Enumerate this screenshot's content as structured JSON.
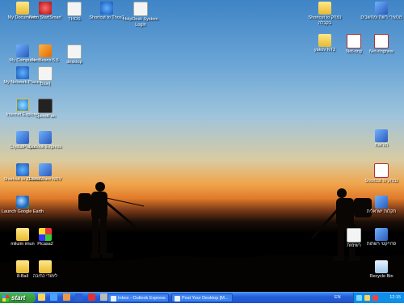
{
  "icons_left": [
    {
      "label": "My Documents",
      "glyph": "g-folder",
      "icon": "my-documents-icon"
    },
    {
      "label": "Nero StartSmart",
      "glyph": "g-red",
      "icon": "nero-icon"
    },
    {
      "label": "THOS",
      "glyph": "g-doc",
      "icon": "document-icon"
    },
    {
      "label": "Shortcut to Thos1",
      "glyph": "g-net",
      "icon": "network-shortcut-icon"
    },
    {
      "label": "HelpDesk System Login",
      "glyph": "g-doc",
      "icon": "document-icon"
    },
    {
      "label": "My Computer",
      "glyph": "g-app",
      "icon": "my-computer-icon"
    },
    {
      "label": "NetBeans 5.5",
      "glyph": "g-orange",
      "icon": "netbeans-icon"
    },
    {
      "label": "desktop",
      "glyph": "g-doc",
      "icon": "document-icon"
    },
    {
      "label": "My Network Places",
      "glyph": "g-net",
      "icon": "network-places-icon"
    },
    {
      "label": "Bluej",
      "glyph": "g-doc",
      "icon": "bluej-icon"
    },
    {
      "label": "Internet Explorer",
      "glyph": "g-ie",
      "icon": "internet-explorer-icon"
    },
    {
      "label": "SpeedFan",
      "glyph": "g-dark",
      "icon": "speedfan-icon"
    },
    {
      "label": "CrystalPlayer",
      "glyph": "g-app",
      "icon": "crystal-player-icon"
    },
    {
      "label": "Outlook Express",
      "glyph": "g-app",
      "icon": "outlook-express-icon"
    },
    {
      "label": "Shortcut to ZHRCC",
      "glyph": "g-net",
      "icon": "network-shortcut-icon"
    },
    {
      "label": "DameWare NRV",
      "glyph": "g-app",
      "icon": "dameware-icon"
    },
    {
      "label": "Launch Google Earth",
      "glyph": "g-earth",
      "icon": "google-earth-icon"
    },
    {
      "label": "miluim imun",
      "glyph": "g-folder",
      "icon": "folder-icon"
    },
    {
      "label": "Picasa2",
      "glyph": "g-pie",
      "icon": "picasa-icon"
    },
    {
      "label": "8-Ball",
      "glyph": "g-folder",
      "icon": "folder-icon"
    },
    {
      "label": "לימודי כתיבה",
      "glyph": "g-folder",
      "icon": "folder-icon"
    }
  ],
  "icons_right": [
    {
      "label": "Shortcut to נמחק בקבלה",
      "glyph": "g-folder",
      "icon": "folder-shortcut-icon"
    },
    {
      "label": "מכשירי רשת ומחשבים",
      "glyph": "g-app",
      "icon": "network-icon"
    },
    {
      "label": "yakov NT2",
      "glyph": "g-folder",
      "icon": "folder-icon"
    },
    {
      "label": "Net-ring",
      "glyph": "g-pdf",
      "icon": "pdf-icon"
    },
    {
      "label": "Net-ringnew",
      "glyph": "g-pdf",
      "icon": "pdf-icon"
    },
    {
      "label": "הוראות",
      "glyph": "g-app",
      "icon": "document-icon"
    },
    {
      "label": "Shortcut to נמחק",
      "glyph": "g-pdf",
      "icon": "pdf-icon"
    },
    {
      "label": "תקלות ישראלית",
      "glyph": "g-app",
      "icon": "monitor-icon"
    },
    {
      "label": "רשימות",
      "glyph": "g-doc",
      "icon": "document-icon"
    },
    {
      "label": "פרוייקטי רשתות",
      "glyph": "g-app",
      "icon": "network-icon"
    },
    {
      "label": "Recycle Bin",
      "glyph": "g-bin",
      "icon": "recycle-bin-icon"
    }
  ],
  "taskbar": {
    "start_label": "start",
    "tasks": [
      {
        "label": "Inbox - Outlook Express"
      },
      {
        "label": "Post Your Desktop [M..."
      }
    ],
    "language": "EN",
    "clock": "12:15"
  }
}
